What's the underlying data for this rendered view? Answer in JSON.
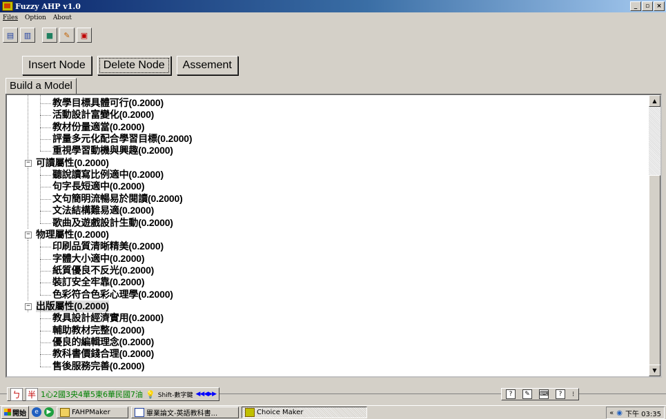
{
  "window": {
    "title": "Fuzzy AHP v1.0",
    "minimize": "_",
    "maximize": "▫",
    "close": "×"
  },
  "menu": [
    "Files",
    "Option",
    "About"
  ],
  "toolbar": [
    {
      "name": "toolbar-button-1",
      "icon": "▤"
    },
    {
      "name": "toolbar-button-2",
      "icon": "▥"
    },
    {
      "name": "toolbar-button-3",
      "icon": "■"
    },
    {
      "name": "toolbar-button-4",
      "icon": "✎"
    },
    {
      "name": "toolbar-button-5",
      "icon": "▣"
    }
  ],
  "actions": {
    "insert": "Insert Node",
    "delete": "Delete Node",
    "assess": "Assement"
  },
  "tab": {
    "label": "Build a Model"
  },
  "tree": {
    "group0_children": [
      "教學目標具體可行(0.2000)",
      "活動設計富變化(0.2000)",
      "教材份量適當(0.2000)",
      "評量多元化配合學習目標(0.2000)",
      "重視學習動機與興趣(0.2000)"
    ],
    "groups": [
      {
        "label": "可讀屬性(0.2000)",
        "children": [
          "聽說讀寫比例適中(0.2000)",
          "句字長短適中(0.2000)",
          "文句簡明流暢易於閱讀(0.2000)",
          "文法結構難易適(0.2000)",
          "歌曲及遊戲設計生動(0.2000)"
        ]
      },
      {
        "label": "物理屬性(0.2000)",
        "children": [
          "印刷品質清晰精美(0.2000)",
          "字體大小適中(0.2000)",
          "紙質優良不反光(0.2000)",
          "裝訂安全牢靠(0.2000)",
          "色彩符合色彩心理學(0.2000)"
        ]
      },
      {
        "label": "出版屬性(0.2000)",
        "children": [
          "教具設計經濟實用(0.2000)",
          "輔助教材完整(0.2000)",
          "優良的編輯理念(0.2000)",
          "教科書價錢合理(0.2000)",
          "售後服務完善(0.2000)"
        ]
      }
    ],
    "selected_group": 2
  },
  "ime": {
    "mode1": "ㄅ",
    "mode2": "半",
    "keys": "1心2國3央4華5東6華民國7油",
    "tip": "Shift-數字鍵",
    "nav": "◀◀◀▶▶"
  },
  "taskbar": {
    "start": "開始",
    "tasks": [
      "FAHPMaker",
      "畢業論文-英語教科書...",
      "Choice Maker"
    ],
    "active_task": 2,
    "tray_arrows": "«",
    "clock": "下午 03:35"
  }
}
